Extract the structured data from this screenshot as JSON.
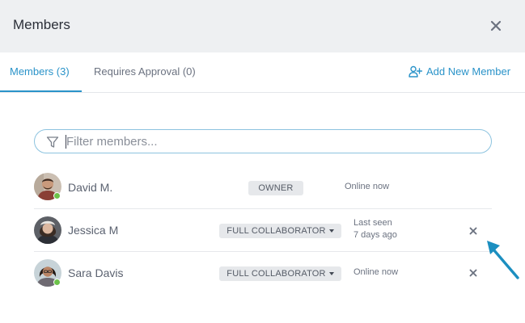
{
  "dialog": {
    "title": "Members",
    "close_icon": "close-icon"
  },
  "tabs": [
    {
      "label": "Members (3)",
      "active": true
    },
    {
      "label": "Requires Approval (0)",
      "active": false
    }
  ],
  "add_member": {
    "label": "Add New Member",
    "icon": "add-user-icon"
  },
  "filter": {
    "placeholder": "Filter members...",
    "value": "",
    "icon": "filter-icon"
  },
  "members": [
    {
      "name": "David M.",
      "role": "OWNER",
      "role_editable": false,
      "presence": [
        "Online now"
      ],
      "online": true,
      "removable": false
    },
    {
      "name": "Jessica M",
      "role": "FULL COLLABORATOR",
      "role_editable": true,
      "presence": [
        "Last seen",
        "7 days ago"
      ],
      "online": false,
      "removable": true
    },
    {
      "name": "Sara Davis",
      "role": "FULL COLLABORATOR",
      "role_editable": true,
      "presence": [
        "Online now"
      ],
      "online": true,
      "removable": true
    }
  ],
  "colors": {
    "accent": "#2a93c9",
    "header_bg": "#eef0f2",
    "online_dot": "#6cc24a",
    "badge_bg": "#e6e8eb",
    "pointer_arrow": "#1c8fc0"
  }
}
